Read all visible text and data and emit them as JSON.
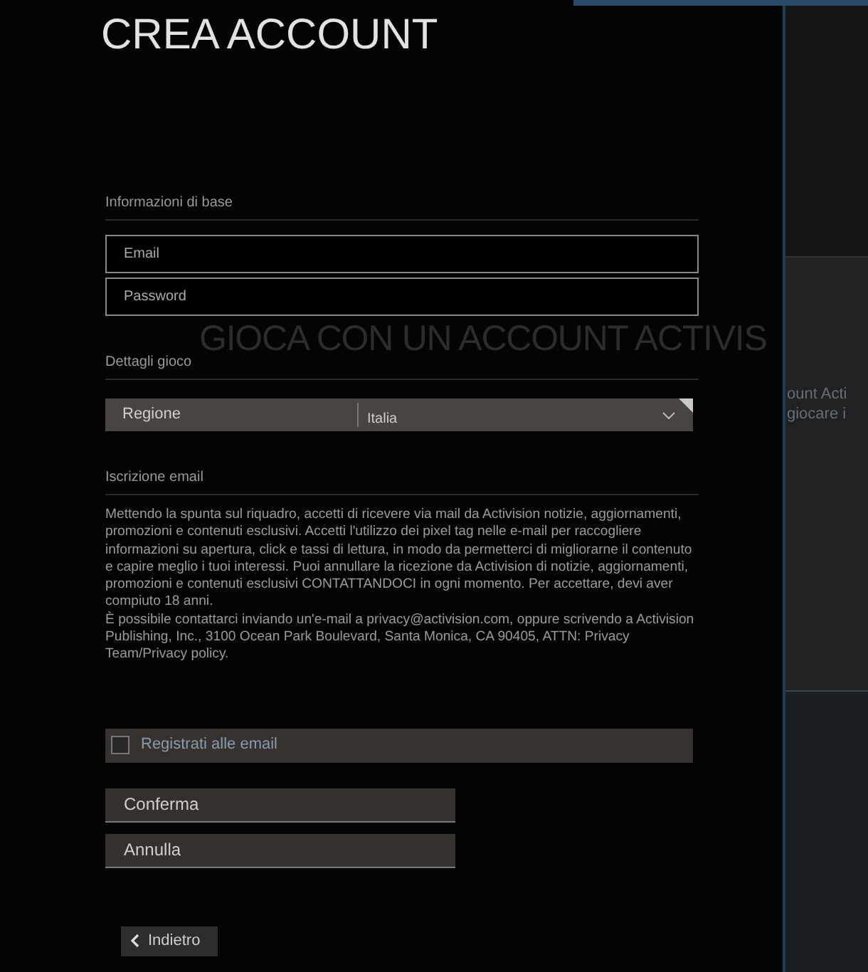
{
  "title": "CREA ACCOUNT",
  "background": {
    "heading": "GIOCA CON UN ACCOUNT ACTIVIS",
    "lines": [
      "ount Acti",
      "giocare i"
    ]
  },
  "sections": [
    {
      "kind": "fields",
      "label": "Informazioni di base",
      "fields": [
        {
          "placeholder": "Email"
        },
        {
          "placeholder": "Password"
        }
      ]
    },
    {
      "kind": "select",
      "label": "Dettagli gioco",
      "select": {
        "label": "Regione",
        "value": "Italia"
      }
    },
    {
      "kind": "text",
      "label": "Iscrizione email",
      "paragraphs": [
        "Mettendo la spunta sul riquadro, accetti di ricevere via mail da Activision notizie, aggiornamenti, promozioni e contenuti esclusivi. Accetti l'utilizzo dei pixel tag nelle e-mail per raccogliere informazioni su apertura, click e tassi di lettura, in modo da permetterci di migliorarne il contenuto e capire meglio i tuoi interessi. Puoi annullare la ricezione da Activision di notizie, aggiornamenti, promozioni e contenuti esclusivi CONTATTANDOCI in ogni momento. Per accettare, devi aver compiuto 18 anni.",
        "È possibile contattarci inviando un'e-mail a privacy@activision.com, oppure scrivendo a Activision Publishing, Inc., 3100 Ocean Park Boulevard, Santa Monica, CA 90405, ATTN: Privacy Team/Privacy policy."
      ]
    }
  ],
  "checkbox": {
    "label": "Registrati alle email",
    "checked": false
  },
  "buttons": [
    "Conferma",
    "Annulla"
  ],
  "back": "Indietro"
}
